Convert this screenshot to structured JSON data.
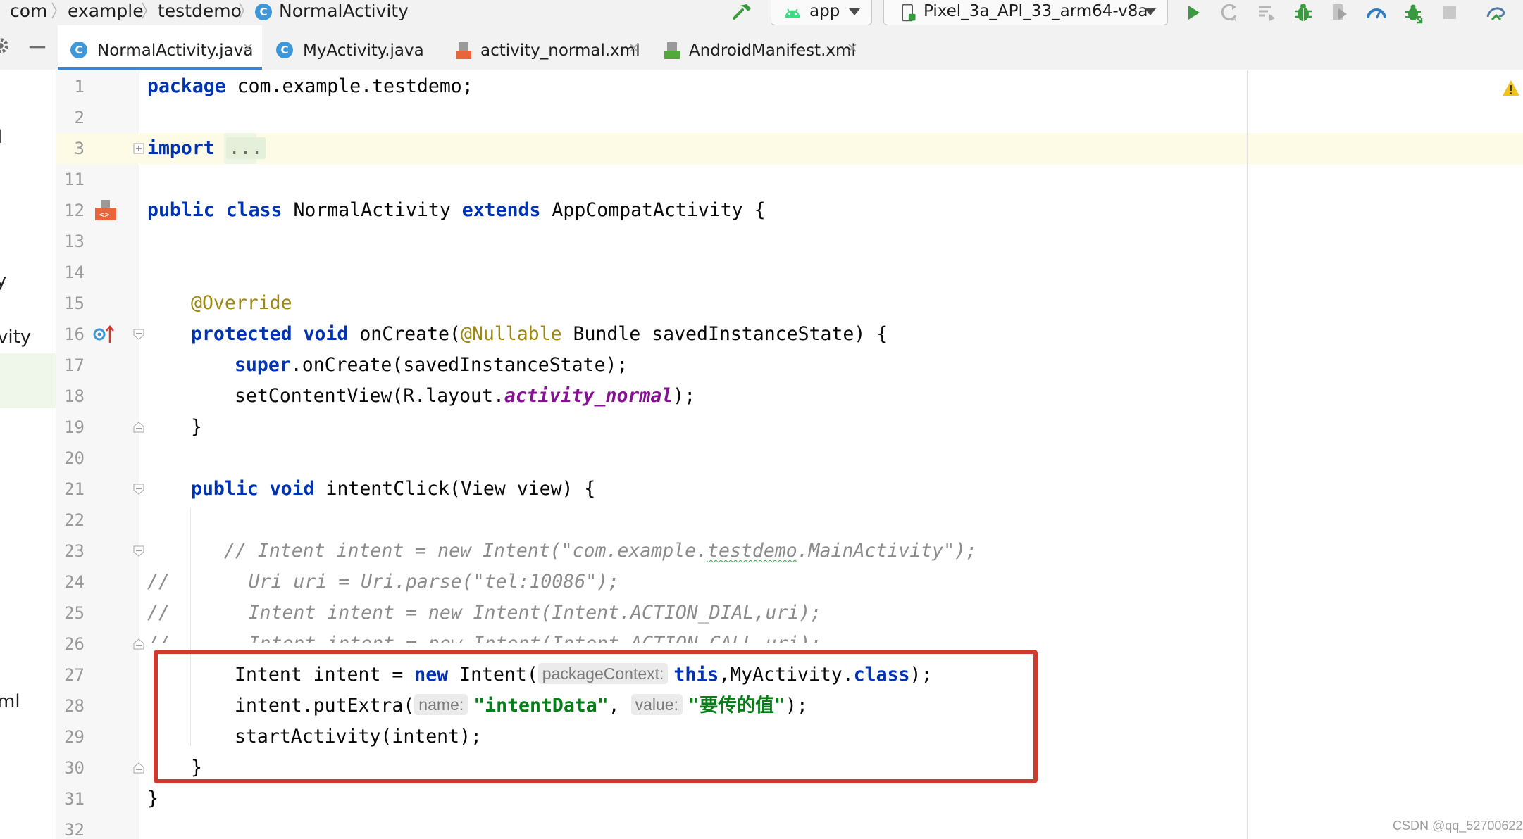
{
  "breadcrumb": [
    "com",
    "example",
    "testdemo",
    "NormalActivity"
  ],
  "class_icon_letter": "C",
  "run_config": "app",
  "device": "Pixel_3a_API_33_arm64-v8a",
  "tabs": [
    {
      "label": "NormalActivity.java",
      "icon": "java-class-icon",
      "active": true
    },
    {
      "label": "MyActivity.java",
      "icon": "java-class-icon",
      "active": false
    },
    {
      "label": "activity_normal.xml",
      "icon": "xml-layout-icon",
      "active": false
    },
    {
      "label": "AndroidManifest.xml",
      "icon": "manifest-icon",
      "active": false
    }
  ],
  "manifest_badge": "MF",
  "xml_badge": "<>",
  "project_fragments": [
    "l",
    "y",
    "vity",
    "ml"
  ],
  "line_numbers": [
    "1",
    "2",
    "3",
    "11",
    "12",
    "13",
    "14",
    "15",
    "16",
    "17",
    "18",
    "19",
    "20",
    "21",
    "22",
    "23",
    "24",
    "25",
    "26",
    "27",
    "28",
    "29",
    "30",
    "31",
    "32"
  ],
  "code": {
    "package_kw": "package",
    "package_name": " com.example.testdemo;",
    "import_kw": "import",
    "import_fold": "...",
    "public_kw": "public",
    "class_kw": "class",
    "class_name": " NormalActivity ",
    "extends_kw": "extends",
    "superclass": " AppCompatActivity {",
    "override_ann": "@Override",
    "protected_kw": "protected",
    "void_kw": "void",
    "oncreate_sig": " onCreate(",
    "nullable_ann": "@Nullable",
    "oncreate_params": " Bundle savedInstanceState) {",
    "super_kw": "super",
    "super_call": ".onCreate(savedInstanceState);",
    "setcontent_call": "setContentView(R.layout.",
    "layout_field": "activity_normal",
    "setcontent_end": ");",
    "close_brace": "}",
    "intentclick_sig": " intentClick(View view) {",
    "comment_23_a": "// Intent intent = new Intent(\"com.example.",
    "comment_23_b": "testdemo",
    "comment_23_c": ".MainActivity\");",
    "comment_24": "//       Uri uri = Uri.parse(\"tel:10086\");",
    "comment_25": "//       Intent intent = new Intent(Intent.ACTION_DIAL,uri);",
    "comment_26": "//       Intent intent = new Intent(Intent.ACTION_CALL,uri);",
    "line27_a": "Intent intent = ",
    "new_kw": "new",
    "line27_b": " Intent(",
    "hint_package_context": "packageContext:",
    "this_kw": "this",
    "line27_c": ",MyActivity.",
    "line27_d": ");",
    "line28_a": "intent.putExtra(",
    "hint_name": "name:",
    "str_intent_data": "\"intentData\"",
    "comma": ", ",
    "hint_value": "value:",
    "str_value": "\"要传的值\"",
    "line28_end": ");",
    "line29": "startActivity(intent);"
  },
  "watermark": "CSDN @qq_52700622",
  "colors": {
    "keyword": "#0033b3",
    "string": "#067d17",
    "annotation": "#9e880d",
    "comment": "#8c8c8c",
    "static_field": "#871094",
    "highlight_box": "#d0392f"
  }
}
